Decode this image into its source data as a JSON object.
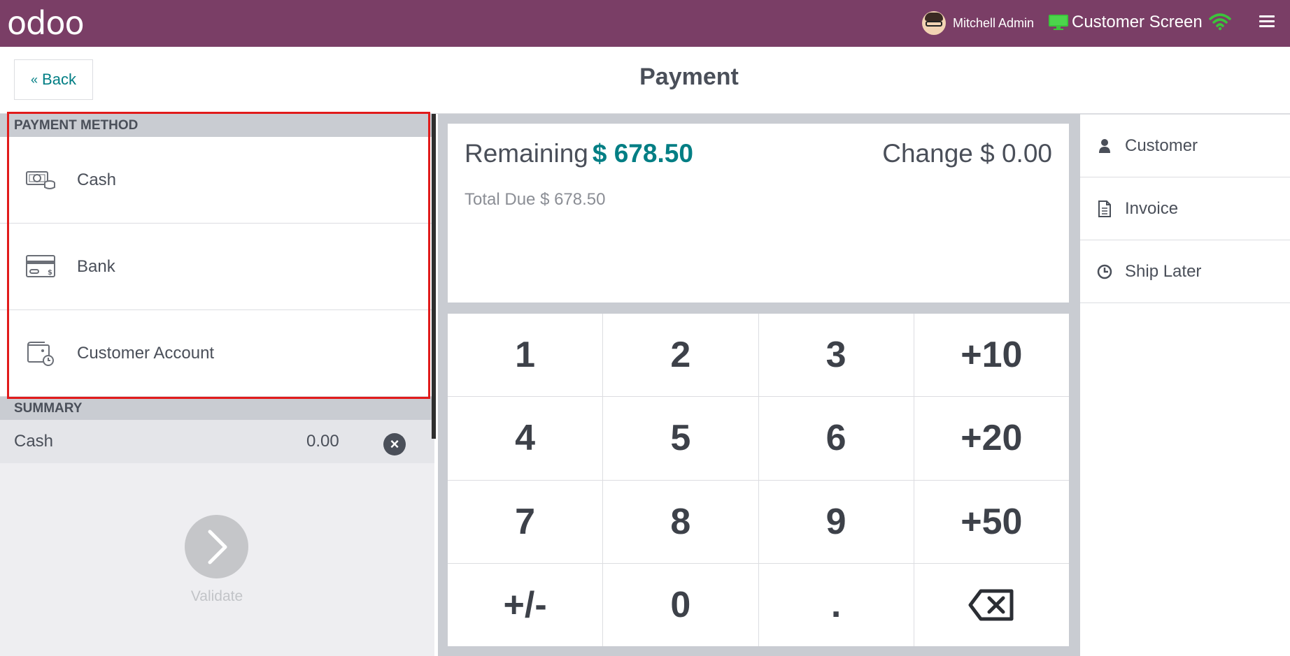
{
  "navbar": {
    "logo": "odoo",
    "user_name": "Mitchell Admin",
    "customer_screen": "Customer Screen",
    "accent_color": "#7a3e66",
    "wifi_color": "#3bc43b",
    "screen_icon_color": "#3bc43b"
  },
  "header": {
    "back_label": "Back",
    "title": "Payment"
  },
  "payment_methods": {
    "heading": "PAYMENT METHOD",
    "items": [
      {
        "label": "Cash",
        "icon": "cash-icon"
      },
      {
        "label": "Bank",
        "icon": "bank-card-icon"
      },
      {
        "label": "Customer Account",
        "icon": "customer-account-icon"
      }
    ]
  },
  "summary": {
    "heading": "SUMMARY",
    "lines": [
      {
        "method": "Cash",
        "amount": "0.00"
      }
    ]
  },
  "validate": {
    "label": "Validate"
  },
  "due": {
    "remaining_label": "Remaining",
    "remaining_value": "$ 678.50",
    "change_label": "Change",
    "change_value": "$ 0.00",
    "total_due_label": "Total Due",
    "total_due_value": "$ 678.50",
    "remaining_color": "#017e84"
  },
  "numpad": {
    "keys": [
      "1",
      "2",
      "3",
      "+10",
      "4",
      "5",
      "6",
      "+20",
      "7",
      "8",
      "9",
      "+50",
      "+/-",
      "0",
      ".",
      "backspace"
    ]
  },
  "actions": {
    "items": [
      {
        "label": "Customer",
        "icon": "user-icon"
      },
      {
        "label": "Invoice",
        "icon": "document-icon"
      },
      {
        "label": "Ship Later",
        "icon": "clock-icon"
      }
    ]
  }
}
